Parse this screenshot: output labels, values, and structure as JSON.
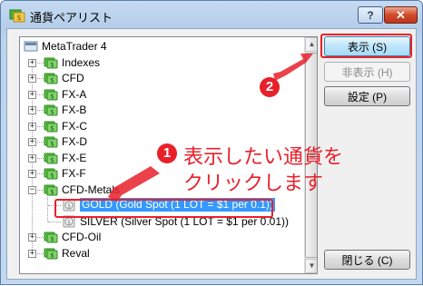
{
  "window": {
    "title": "通貨ペアリスト"
  },
  "titlebar": {
    "help_label": "?",
    "close_label": "✕"
  },
  "tree": {
    "root": "MetaTrader 4",
    "groups": [
      "Indexes",
      "CFD",
      "FX-A",
      "FX-B",
      "FX-C",
      "FX-D",
      "FX-E",
      "FX-F",
      "CFD-Metals"
    ],
    "expanded_group": "CFD-Metals",
    "children": [
      "GOLD  (Gold Spot (1 LOT = $1 per 0.1))",
      "SILVER  (Silver Spot (1 LOT = $1 per 0.01))"
    ],
    "groups_after": [
      "CFD-Oil",
      "Reval"
    ],
    "selected_index": 0
  },
  "buttons": {
    "show": "表示 (S)",
    "hide": "非表示 (H)",
    "settings": "設定 (P)",
    "close": "閉じる (C)"
  },
  "callouts": {
    "step1_number": "1",
    "step1_line1": "表示したい通貨を",
    "step1_line2": "クリックします",
    "step2_number": "2"
  },
  "colors": {
    "accent_red": "#e8202a",
    "selection_blue": "#3399ff",
    "folder_green": "#3cab2a"
  }
}
